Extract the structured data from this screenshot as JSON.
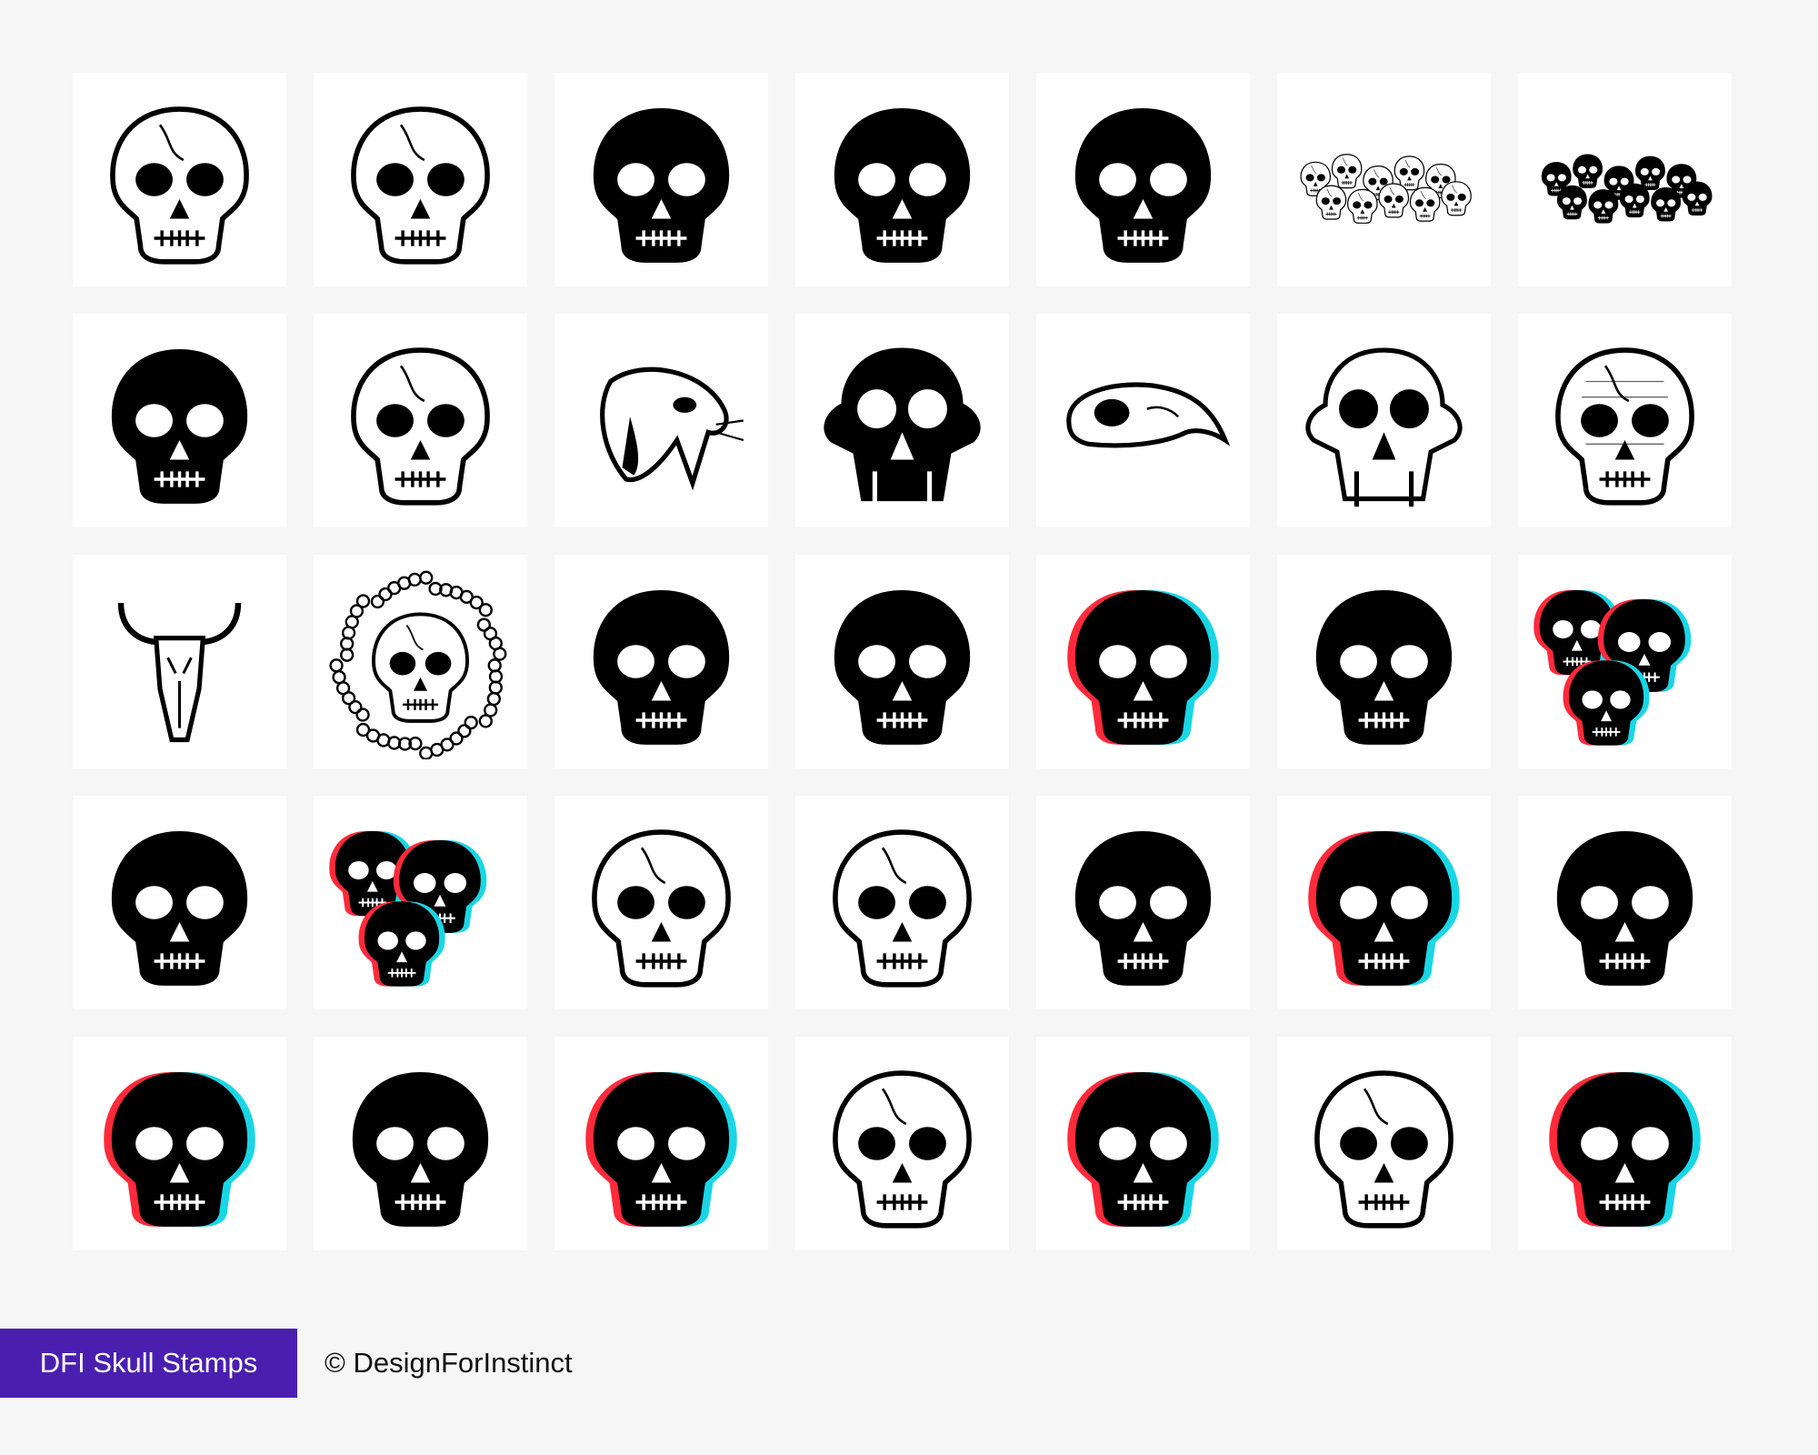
{
  "brand": {
    "badge_label": "DFI Skull Stamps",
    "credit": "© DesignForInstinct",
    "badge_color": "#4a1fb0"
  },
  "stamps": [
    {
      "icon": "skull-outline-icon",
      "style": "outline"
    },
    {
      "icon": "skull-outline-icon",
      "style": "outline"
    },
    {
      "icon": "skull-solid-icon",
      "style": "solid"
    },
    {
      "icon": "skull-solid-icon",
      "style": "solid"
    },
    {
      "icon": "skull-solid-icon",
      "style": "solid"
    },
    {
      "icon": "skull-pile-outline-icon",
      "style": "pile-outline"
    },
    {
      "icon": "skull-pile-solid-icon",
      "style": "pile-solid"
    },
    {
      "icon": "skull-solid-icon",
      "style": "solid"
    },
    {
      "icon": "skull-outline-icon",
      "style": "outline"
    },
    {
      "icon": "big-cat-skull-icon",
      "style": "cat"
    },
    {
      "icon": "ape-skull-solid-icon",
      "style": "ape-solid"
    },
    {
      "icon": "bird-skull-icon",
      "style": "bird"
    },
    {
      "icon": "ape-skull-outline-icon",
      "style": "ape-outline"
    },
    {
      "icon": "skull-sketch-icon",
      "style": "sketch"
    },
    {
      "icon": "bull-skull-icon",
      "style": "bull"
    },
    {
      "icon": "skull-curly-hair-icon",
      "style": "hair"
    },
    {
      "icon": "skull-solid-icon",
      "style": "solid"
    },
    {
      "icon": "skull-solid-icon",
      "style": "solid"
    },
    {
      "icon": "skull-anaglyph-icon",
      "style": "anaglyph"
    },
    {
      "icon": "skull-solid-icon",
      "style": "solid"
    },
    {
      "icon": "skull-cluster-anaglyph-icon",
      "style": "cluster-anaglyph"
    },
    {
      "icon": "skull-solid-icon",
      "style": "solid"
    },
    {
      "icon": "skull-cluster-anaglyph-icon",
      "style": "cluster-anaglyph"
    },
    {
      "icon": "skull-outline-icon",
      "style": "outline"
    },
    {
      "icon": "skull-outline-icon",
      "style": "outline"
    },
    {
      "icon": "skull-solid-icon",
      "style": "solid"
    },
    {
      "icon": "skull-anaglyph-icon",
      "style": "anaglyph"
    },
    {
      "icon": "skull-solid-icon",
      "style": "solid"
    },
    {
      "icon": "skull-anaglyph-icon",
      "style": "anaglyph"
    },
    {
      "icon": "skull-solid-icon",
      "style": "solid"
    },
    {
      "icon": "skull-anaglyph-icon",
      "style": "anaglyph"
    },
    {
      "icon": "skull-outline-icon",
      "style": "outline"
    },
    {
      "icon": "skull-anaglyph-icon",
      "style": "anaglyph"
    },
    {
      "icon": "skull-outline-icon",
      "style": "outline"
    },
    {
      "icon": "skull-anaglyph-icon",
      "style": "anaglyph"
    }
  ]
}
